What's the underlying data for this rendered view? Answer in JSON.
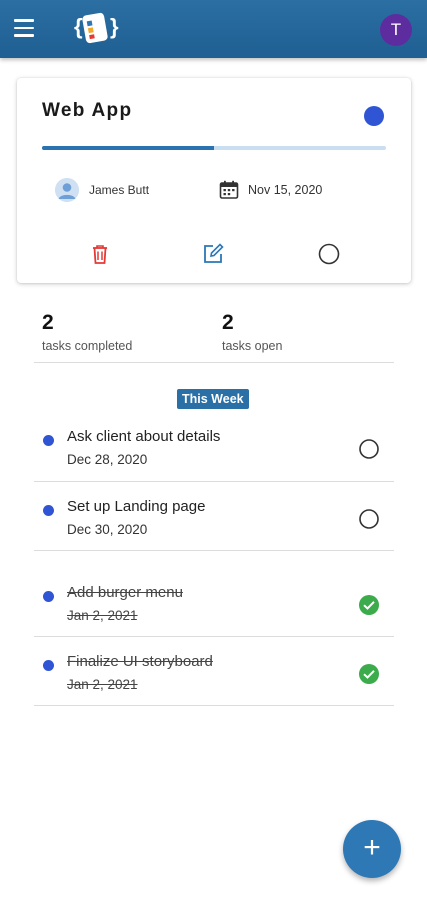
{
  "header": {
    "menu_icon": "hamburger-menu-icon",
    "logo_icon": "app-logo-icon",
    "avatar_initial": "T",
    "avatar_color": "#5d2da0",
    "bar_color": "#2a6ca0"
  },
  "project": {
    "title": "Web App",
    "color": "#2f55d4",
    "progress": 0.5,
    "owner": "James Butt",
    "due_date": "Nov 15, 2020",
    "actions": [
      {
        "icon": "trash-icon",
        "color": "#e53935"
      },
      {
        "icon": "edit-icon",
        "color": "#2a78b8"
      },
      {
        "icon": "circle-icon",
        "color": "#333333"
      }
    ]
  },
  "stats": {
    "completed_count": "2",
    "completed_label": "tasks completed",
    "open_count": "2",
    "open_label": "tasks open"
  },
  "section_label": "This Week",
  "tasks": [
    {
      "title": "Ask client about details",
      "date": "Dec 28, 2020",
      "done": false
    },
    {
      "title": "Set up Landing page",
      "date": "Dec 30, 2020",
      "done": false
    },
    {
      "title": "Add burger menu",
      "date": "Jan 2, 2021",
      "done": true
    },
    {
      "title": "Finalize UI storyboard",
      "date": "Jan 2, 2021",
      "done": true
    }
  ],
  "fab": {
    "label": "+",
    "icon": "plus-icon"
  }
}
